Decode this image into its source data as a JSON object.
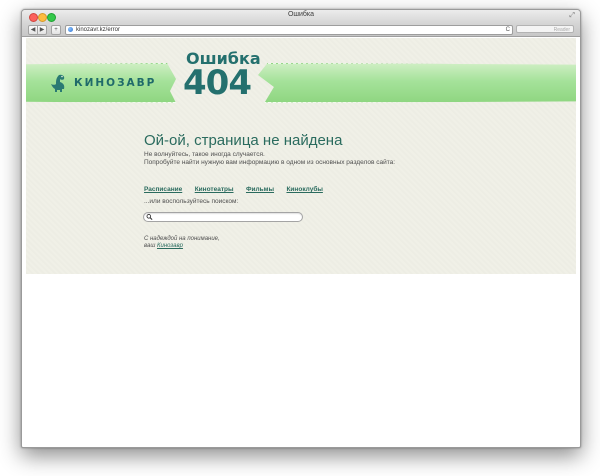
{
  "window": {
    "title": "Ошибка",
    "url": "kinozavr.kz/error",
    "reader_label": "Reader"
  },
  "brand": {
    "name": "КИНОЗАВР"
  },
  "error": {
    "title": "Ошибка",
    "code": "404",
    "headline": "Ой-ой, страница не найдена",
    "line1": "Не волнуйтесь, такое иногда случается.",
    "line2": "Попробуйте найти нужную вам информацию в одном из основных разделов сайта:"
  },
  "nav": {
    "links": [
      "Расписание",
      "Кинотеатры",
      "Фильмы",
      "Киноклубы"
    ]
  },
  "search": {
    "hint": "...или воспользуйтесь поиском:",
    "value": ""
  },
  "signature": {
    "line1": "С надеждой на понимание,",
    "line2_prefix": "ваш ",
    "line2_link": "Кинозавр"
  },
  "colors": {
    "accent": "#24706e",
    "page_bg": "#f0f0e7",
    "tape_green": "#a5e29a"
  }
}
